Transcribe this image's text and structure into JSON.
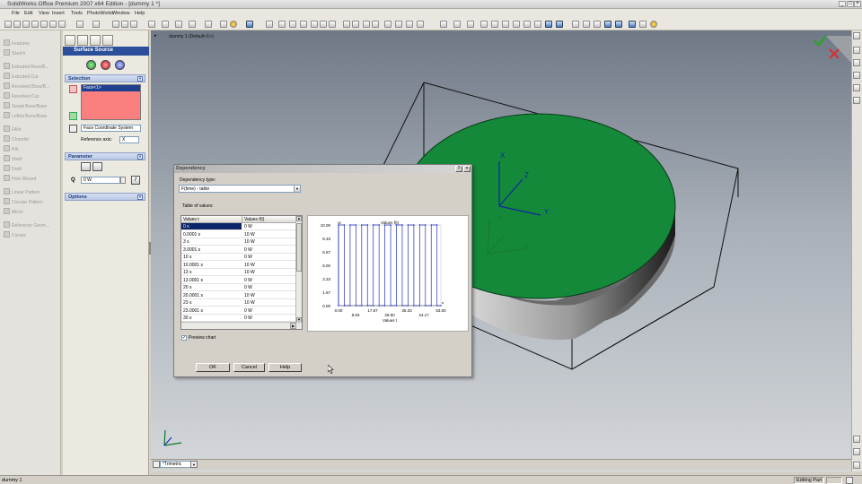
{
  "window": {
    "title": "SolidWorks Office Premium 2007 x64 Edition - [dummy 1 *]",
    "min": "_",
    "max": "□",
    "close": "×"
  },
  "menu": [
    "File",
    "Edit",
    "View",
    "Insert",
    "Tools",
    "PhotoWorks",
    "Window",
    "Help"
  ],
  "feature_tree": [
    "Features",
    "Sketch",
    "Extruded Boss/B...",
    "Extruded Cut",
    "Revolved Boss/B...",
    "Revolved Cut",
    "Swept Boss/Base",
    "Lofted Boss/Base",
    "Fillet",
    "Chamfer",
    "Rib",
    "Shell",
    "Draft",
    "Hole Wizard",
    "Linear Pattern",
    "Circular Pattern",
    "Mirror",
    "Reference Geom...",
    "Curves"
  ],
  "property_manager": {
    "title": "Surface Source",
    "selection_label": "Selection",
    "selected_face": "Face<1>",
    "coord_system": "Face Coordinate System",
    "ref_axis_label": "Reference axis:",
    "ref_axis_value": "X",
    "parameter_label": "Parameter",
    "q_label": "Q",
    "q_value": "0 W",
    "options_label": "Options"
  },
  "viewport": {
    "title": "dummy 1  (Default<1>)",
    "view_name": "*Trimetric"
  },
  "status": {
    "left": "dummy 1",
    "mode": "Editing Part"
  },
  "dialog": {
    "title": "Dependency",
    "help": "?",
    "close": "×",
    "dep_type_label": "Dependency type:",
    "dep_type_value": "F(time) - table",
    "table_label": "Table of values:",
    "col1": "Values t",
    "col2": "Values f(t)",
    "rows": [
      [
        "0 s",
        "0 W"
      ],
      [
        "0.0001 s",
        "10 W"
      ],
      [
        "3 s",
        "10 W"
      ],
      [
        "3.0001 s",
        "0 W"
      ],
      [
        "10 s",
        "0 W"
      ],
      [
        "10.0001 s",
        "10 W"
      ],
      [
        "13 s",
        "10 W"
      ],
      [
        "13.0001 s",
        "0 W"
      ],
      [
        "20 s",
        "0 W"
      ],
      [
        "20.0001 s",
        "10 W"
      ],
      [
        "23 s",
        "10 W"
      ],
      [
        "23.0001 s",
        "0 W"
      ],
      [
        "30 s",
        "0 W"
      ]
    ],
    "preview_label": "Preview chart",
    "preview_checked": "✓",
    "ok": "OK",
    "cancel": "Cancel",
    "help_btn": "Help"
  },
  "chart_data": {
    "type": "line",
    "title": "Values f(t)",
    "xlabel": "Values t",
    "ylabel": "W",
    "x_corner_label": "s",
    "xlim": [
      0,
      53
    ],
    "ylim": [
      0,
      10
    ],
    "xticks": [
      "0.00",
      "8.83",
      "17.67",
      "26.50",
      "35.33",
      "44.17",
      "53.00"
    ],
    "yticks": [
      "10.00",
      "8.33",
      "6.67",
      "5.00",
      "3.33",
      "1.67",
      "0.00"
    ],
    "series": [
      {
        "x": [
          0,
          0.0001,
          3,
          3.0001,
          6,
          6.0001,
          9,
          9.0001,
          12,
          12.0001,
          15,
          15.0001,
          18,
          18.0001,
          21,
          21.0001,
          24,
          24.0001,
          27,
          27.0001,
          30,
          30.0001,
          33,
          33.0001,
          36,
          36.0001,
          39,
          39.0001,
          42,
          42.0001,
          45,
          45.0001,
          48,
          48.0001,
          51,
          51.0001,
          53
        ],
        "y": [
          0,
          10,
          10,
          0,
          0,
          10,
          10,
          0,
          0,
          10,
          10,
          0,
          0,
          10,
          10,
          0,
          0,
          10,
          10,
          0,
          0,
          10,
          10,
          0,
          0,
          10,
          10,
          0,
          0,
          10,
          10,
          0,
          0,
          10,
          10,
          0,
          0
        ]
      }
    ],
    "color": "#2030c0"
  }
}
